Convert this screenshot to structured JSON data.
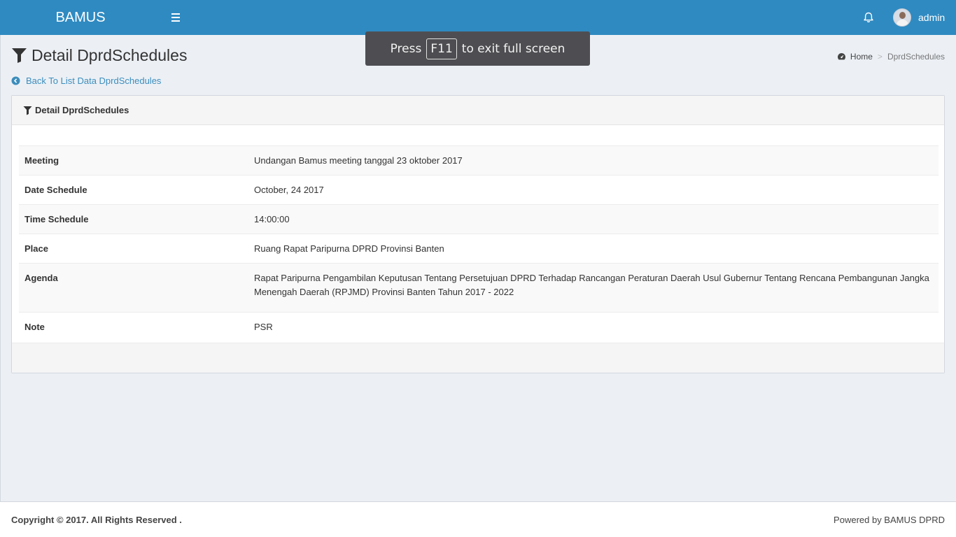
{
  "header": {
    "brand": "BAMUS",
    "user_name": "admin",
    "bg_color": "#2f8ac1"
  },
  "fullscreen_toast": {
    "before": "Press",
    "key": "F11",
    "after": "to exit full screen"
  },
  "page": {
    "title": "Detail DprdSchedules",
    "back_link": "Back To List Data DprdSchedules"
  },
  "breadcrumb": {
    "home": "Home",
    "current": "DprdSchedules"
  },
  "box": {
    "title": "Detail DprdSchedules",
    "rows": [
      {
        "label": "Meeting",
        "value": "Undangan Bamus meeting tanggal 23 oktober 2017"
      },
      {
        "label": "Date Schedule",
        "value": "October, 24 2017"
      },
      {
        "label": "Time Schedule",
        "value": "14:00:00"
      },
      {
        "label": "Place",
        "value": "Ruang Rapat Paripurna DPRD Provinsi Banten"
      },
      {
        "label": "Agenda",
        "value": "Rapat Paripurna Pengambilan Keputusan Tentang Persetujuan DPRD Terhadap Rancangan Peraturan Daerah Usul Gubernur Tentang Rencana Pembangunan Jangka Menengah Daerah (RPJMD) Provinsi Banten Tahun 2017 - 2022"
      },
      {
        "label": "Note",
        "value": "PSR"
      }
    ]
  },
  "footer": {
    "copyright": "Copyright © 2017. All Rights Reserved .",
    "powered": "Powered by BAMUS DPRD"
  },
  "icons": {
    "menu": "hamburger-icon",
    "bell": "bell-icon",
    "title": "filter-icon",
    "home": "dashboard-icon",
    "back": "chevron-circle-left-icon"
  }
}
